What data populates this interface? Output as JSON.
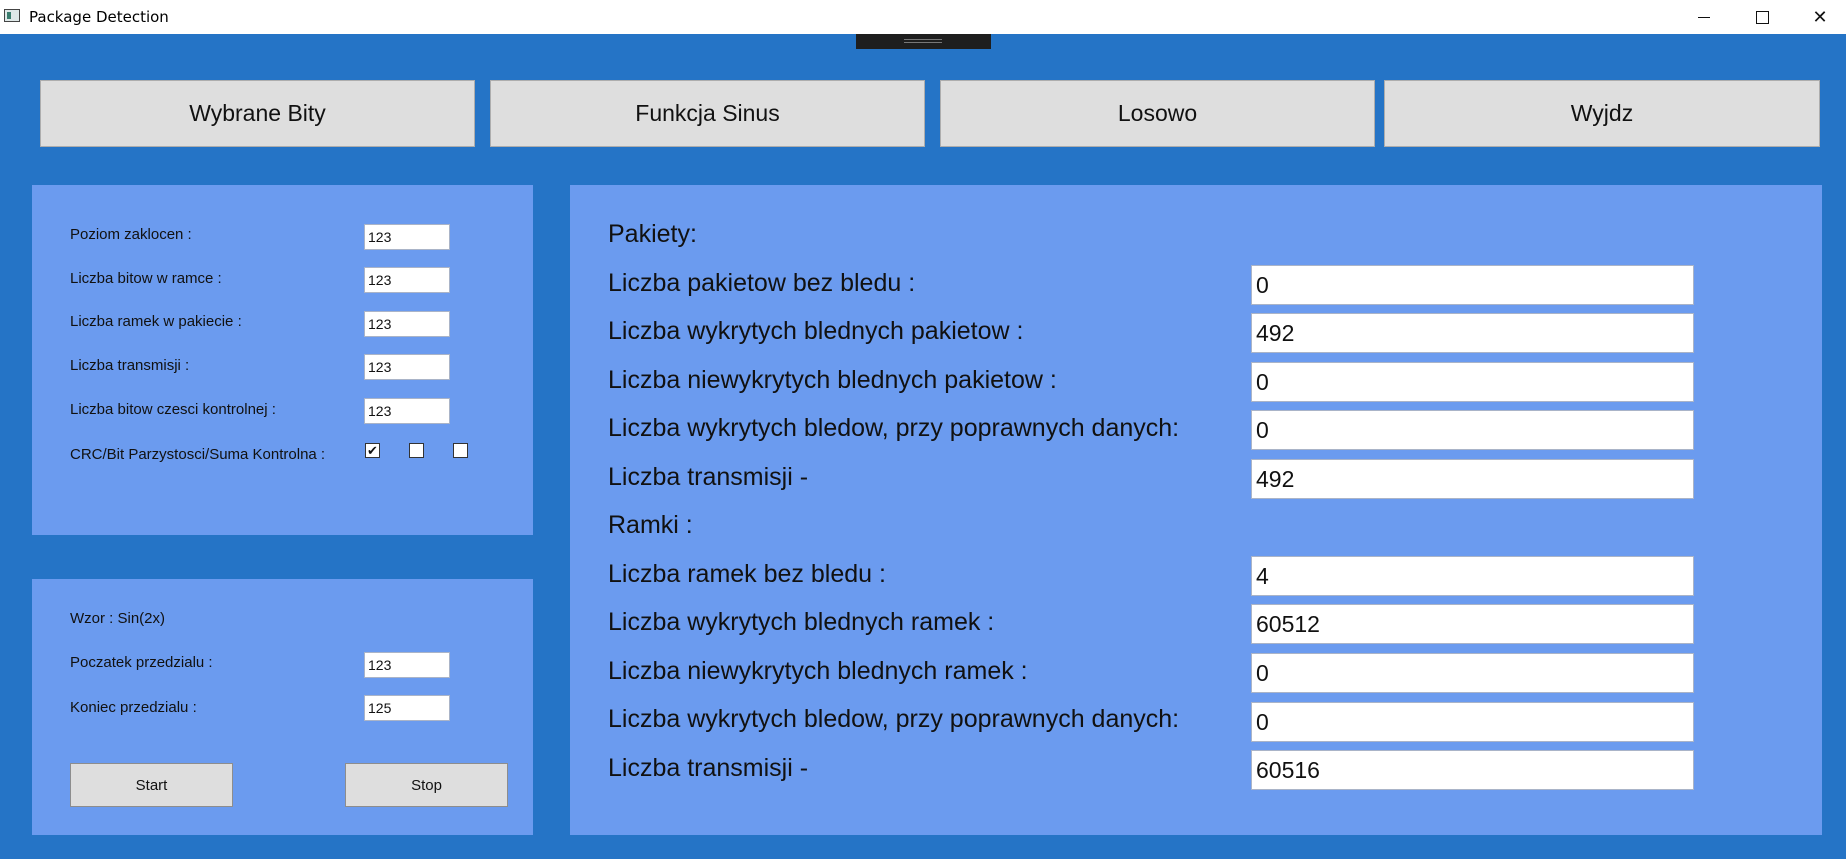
{
  "window": {
    "title": "Package Detection"
  },
  "top_buttons": [
    "Wybrane Bity",
    "Funkcja Sinus",
    "Losowo",
    "Wyjdz"
  ],
  "settings": {
    "noise_label": "Poziom zaklocen :",
    "noise_value": "123",
    "bits_per_frame_label": "Liczba bitow w ramce :",
    "bits_per_frame_value": "123",
    "frames_per_packet_label": "Liczba ramek w pakiecie :",
    "frames_per_packet_value": "123",
    "transmissions_label": "Liczba transmisji :",
    "transmissions_value": "123",
    "control_bits_label": "Liczba bitow czesci kontrolnej :",
    "control_bits_value": "123",
    "method_label": "CRC/Bit Parzystosci/Suma Kontrolna :",
    "method_checks": {
      "crc": true,
      "parity": false,
      "checksum": false
    }
  },
  "sine": {
    "formula_label": "Wzor : Sin(2x)",
    "start_label": "Poczatek przedzialu :",
    "start_value": "123",
    "end_label": "Koniec przedzialu :",
    "end_value": "125",
    "start_button": "Start",
    "stop_button": "Stop"
  },
  "results": {
    "packets_heading": "Pakiety:",
    "packets_ok_label": "Liczba pakietow bez bledu :",
    "packets_ok_value": "0",
    "packets_detected_label": "Liczba wykrytych blednych pakietow :",
    "packets_detected_value": "492",
    "packets_undetected_label": "Liczba niewykrytych blednych pakietow :",
    "packets_undetected_value": "0",
    "packets_false_label": "Liczba wykrytych bledow, przy poprawnych danych:",
    "packets_false_value": "0",
    "packets_transmissions_label": "Liczba transmisji -",
    "packets_transmissions_value": "492",
    "frames_heading": "Ramki :",
    "frames_ok_label": "Liczba ramek bez bledu :",
    "frames_ok_value": "4",
    "frames_detected_label": "Liczba wykrytych blednych ramek :",
    "frames_detected_value": "60512",
    "frames_undetected_label": "Liczba niewykrytych blednych ramek :",
    "frames_undetected_value": "0",
    "frames_false_label": "Liczba wykrytych bledow, przy poprawnych danych:",
    "frames_false_value": "0",
    "frames_transmissions_label": "Liczba transmisji -",
    "frames_transmissions_value": "60516"
  },
  "icons": {
    "app": "app-window-icon",
    "minimize": "minimize-icon",
    "maximize": "maximize-icon",
    "close": "close-icon",
    "checkmark": "checkmark-icon"
  },
  "colors": {
    "background": "#2574c6",
    "panel": "#6b9bef",
    "button": "#dedede"
  }
}
